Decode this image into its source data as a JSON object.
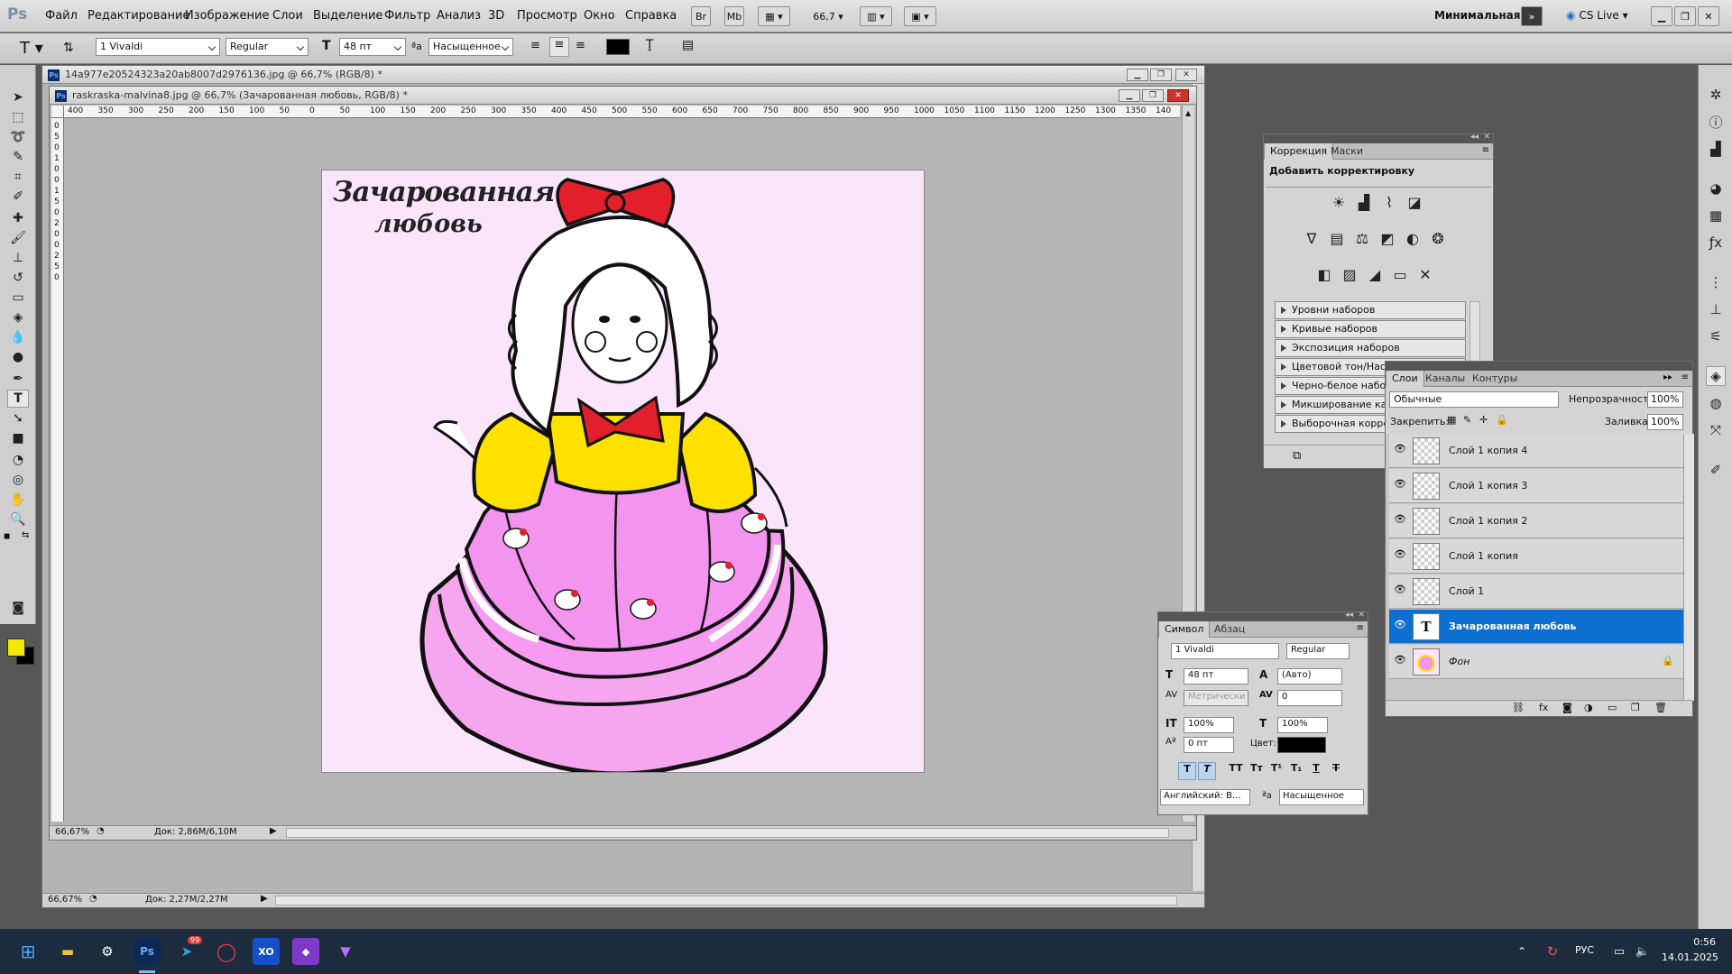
{
  "menubar": {
    "logo": "Ps",
    "items": [
      "Файл",
      "Редактирование",
      "Изображение",
      "Слои",
      "Выделение",
      "Фильтр",
      "Анализ",
      "3D",
      "Просмотр",
      "Окно",
      "Справка"
    ],
    "br_label": "Br",
    "mb_label": "Mb",
    "zoom": "66,7",
    "workspace": "Минимальная",
    "cslive": "CS Live"
  },
  "options": {
    "font_family": "1 Vivaldi",
    "font_style": "Regular",
    "font_size": "48 пт",
    "antialias": "Насыщенное",
    "text_color": "#000000"
  },
  "doc_back": {
    "title": "14a977e20524323a20ab8007d2976136.jpg @ 66,7% (RGB/8) *",
    "zoom": "66,67%",
    "doc_size": "Док: 2,27M/2,27M"
  },
  "doc_front": {
    "title": "raskraska-malvina8.jpg @ 66,7% (Зачарованная любовь, RGB/8) *",
    "zoom": "66,67%",
    "doc_size": "Док: 2,86M/6,10M",
    "ruler_h": [
      "400",
      "350",
      "300",
      "250",
      "200",
      "150",
      "100",
      "50",
      "0",
      "50",
      "100",
      "150",
      "200",
      "250",
      "300",
      "350",
      "400",
      "450",
      "500",
      "550",
      "600",
      "650",
      "700",
      "750",
      "800",
      "850",
      "900",
      "950",
      "1000",
      "1050",
      "1100",
      "1150",
      "1200",
      "1250",
      "1300",
      "1350",
      "140"
    ],
    "ruler_v": [
      "0",
      "5",
      "0",
      "1",
      "0",
      "0",
      "1",
      "5",
      "0",
      "2",
      "0",
      "0",
      "2",
      "5",
      "0"
    ],
    "caption_line1": "Зачарованная",
    "caption_line2": "любовь",
    "canvas_bg": "#fbe5fb"
  },
  "adjustments": {
    "tabs": [
      "Коррекция",
      "Маски"
    ],
    "heading": "Добавить корректировку",
    "presets": [
      "Уровни наборов",
      "Кривые наборов",
      "Экспозиция наборов",
      "Цветовой тон/Насыщ...",
      "Черно-белое наборов",
      "Микширование канал...",
      "Выборочная коррекция..."
    ]
  },
  "layers": {
    "tabs": [
      "Слои",
      "Каналы",
      "Контуры"
    ],
    "blend_mode": "Обычные",
    "opacity_label": "Непрозрачность:",
    "opacity": "100%",
    "lock_label": "Закрепить:",
    "fill_label": "Заливка:",
    "fill": "100%",
    "items": [
      {
        "name": "Слой 1 копия 4"
      },
      {
        "name": "Слой 1 копия 3"
      },
      {
        "name": "Слой 1 копия 2"
      },
      {
        "name": "Слой 1 копия"
      },
      {
        "name": "Слой 1"
      },
      {
        "name": "Зачарованная любовь"
      },
      {
        "name": "Фон"
      }
    ]
  },
  "character": {
    "tabs": [
      "Символ",
      "Абзац"
    ],
    "font_family": "1 Vivaldi",
    "font_style": "Regular",
    "size": "48 пт",
    "leading": "(Авто)",
    "kerning": "Метрически",
    "tracking": "0",
    "vscale": "100%",
    "hscale": "100%",
    "baseline": "0 пт",
    "color_label": "Цвет:",
    "style_buttons": [
      "T",
      "T",
      "TT",
      "Tт",
      "T¹",
      "T₁",
      "T",
      "T"
    ],
    "language": "Английский: В...",
    "antialias": "Насыщенное"
  },
  "taskbar": {
    "telegram_badge": "99",
    "lang": "РУС",
    "time": "0:56",
    "date": "14.01.2025"
  }
}
